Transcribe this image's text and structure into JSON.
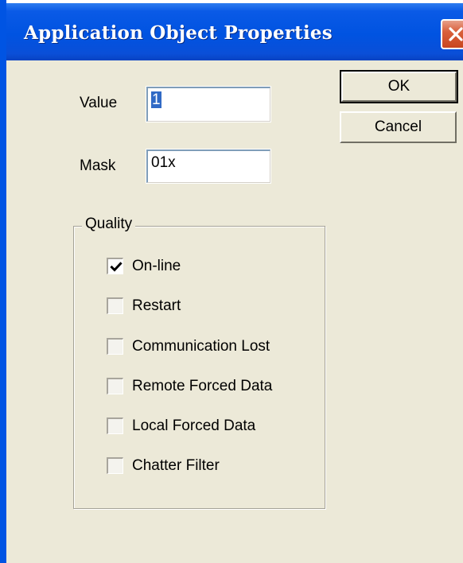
{
  "window": {
    "title": "Application Object Properties"
  },
  "fields": {
    "value_label": "Value",
    "value_text": "1",
    "mask_label": "Mask",
    "mask_text": "01x"
  },
  "buttons": {
    "ok_label": "OK",
    "cancel_label": "Cancel"
  },
  "quality": {
    "legend": "Quality",
    "items": [
      {
        "label": "On-line",
        "checked": true
      },
      {
        "label": "Restart",
        "checked": false
      },
      {
        "label": "Communication Lost",
        "checked": false
      },
      {
        "label": "Remote Forced Data",
        "checked": false
      },
      {
        "label": "Local Forced Data",
        "checked": false
      },
      {
        "label": "Chatter Filter",
        "checked": false
      }
    ]
  },
  "icons": {
    "close": "close-icon",
    "check": "checkmark-icon"
  },
  "colors": {
    "titlebar": "#0054e3",
    "close_button": "#d9603c",
    "dialog_face": "#ece9d8",
    "selection": "#316ac5"
  }
}
